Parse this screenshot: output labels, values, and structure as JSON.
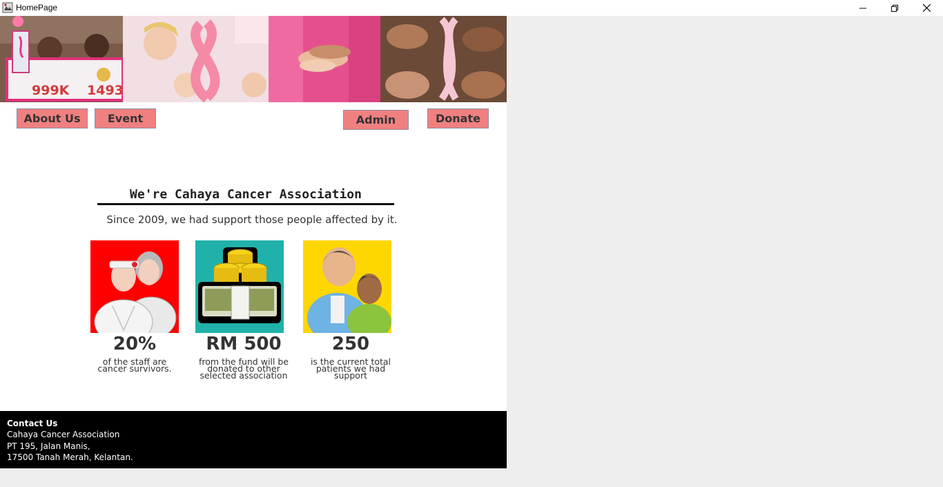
{
  "window": {
    "title": "HomePage"
  },
  "nav": {
    "about": "About Us",
    "event": "Event",
    "admin": "Admin",
    "donate": "Donate"
  },
  "banner": {
    "sign_left": "999K",
    "sign_right": "1493"
  },
  "hero": {
    "heading": "We're Cahaya Cancer Association",
    "subheading": "Since 2009, we had support those people affected by it."
  },
  "stats": [
    {
      "value": "20%",
      "desc_lines": [
        "of the staff are",
        "cancer survivors."
      ],
      "icon": "cancer-survivor-icon"
    },
    {
      "value": "RM 500",
      "desc_lines": [
        "from the fund will be",
        "donated to other",
        "selected association"
      ],
      "icon": "money-stack-icon"
    },
    {
      "value": "250",
      "desc_lines": [
        "is the current total",
        "patients we had",
        "support"
      ],
      "icon": "patients-icon"
    }
  ],
  "footer": {
    "title": "Contact Us",
    "org": "Cahaya Cancer Association",
    "address_line1": "PT 195, Jalan Manis,",
    "address_line2": "17500 Tanah Merah, Kelantan."
  },
  "colors": {
    "button_bg": "#f08080",
    "stat1_bg": "#ff0000",
    "stat2_bg": "#20b2aa",
    "stat3_bg": "#ffd700",
    "footer_bg": "#000000"
  }
}
